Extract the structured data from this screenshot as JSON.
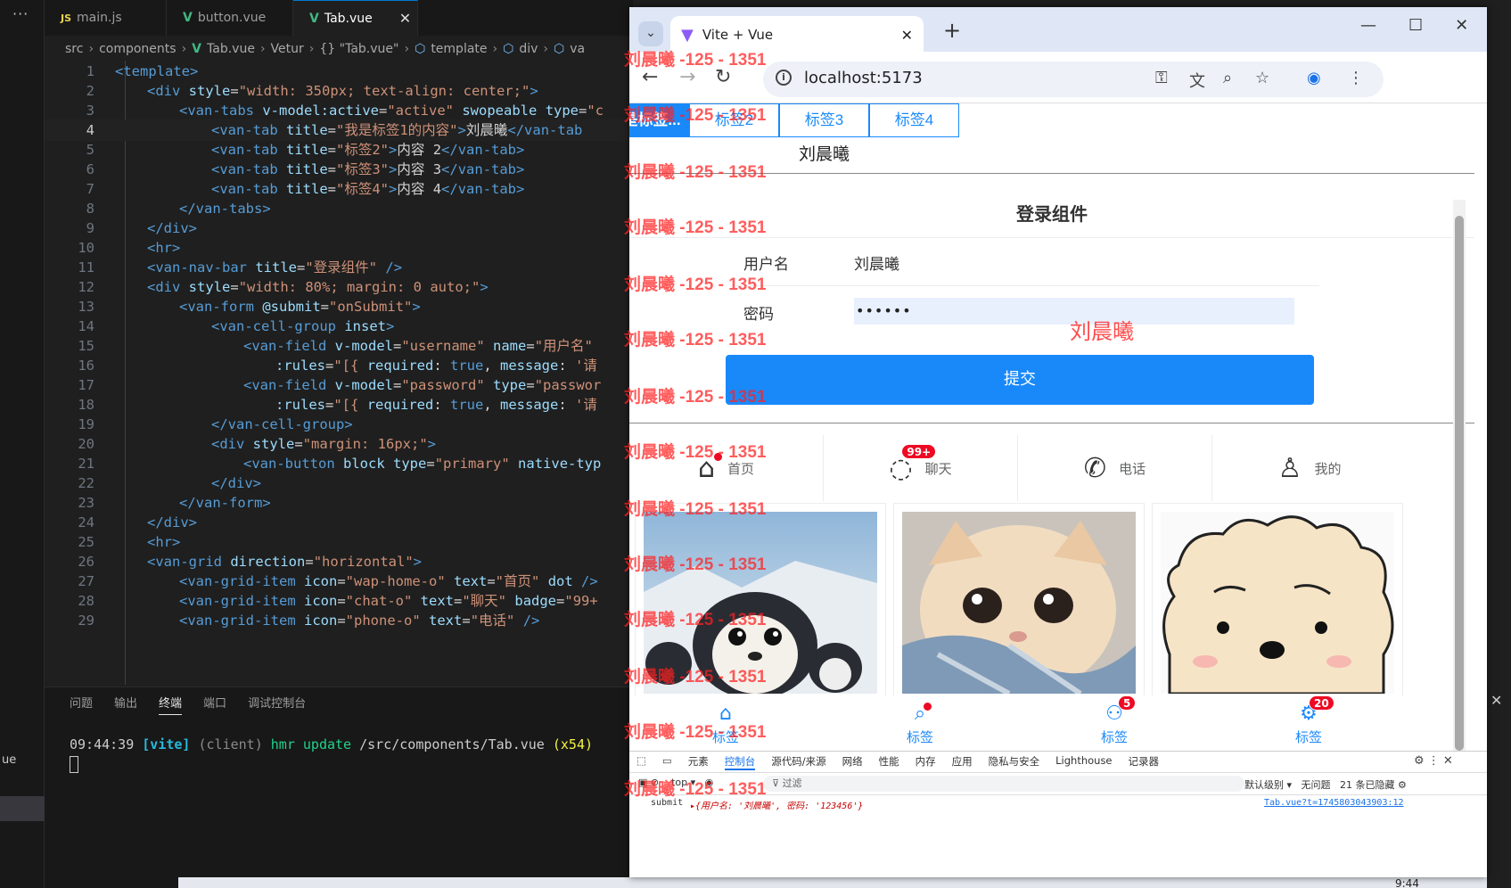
{
  "vscode": {
    "tabs": [
      {
        "icon": "JS",
        "name": "main.js"
      },
      {
        "icon": "V",
        "name": "button.vue"
      },
      {
        "icon": "V",
        "name": "Tab.vue"
      }
    ],
    "breadcrumbs": [
      "src",
      "components",
      "Tab.vue",
      "Vetur",
      "{} \"Tab.vue\"",
      "template",
      "div",
      "va"
    ],
    "code_lines": [
      {
        "n": "1",
        "html": "<span class='tg'>&lt;template&gt;</span>",
        "indent": 0
      },
      {
        "n": "2",
        "html": "<span class='tg'>&lt;div</span> <span class='at'>style</span>=<span class='sv'>\"width: 350px; text-align: center;\"</span><span class='tg'>&gt;</span>",
        "indent": 1
      },
      {
        "n": "3",
        "html": "<span class='tg'>&lt;van-tabs</span> <span class='at'>v-model:active</span>=<span class='sv'>\"active\"</span> <span class='at'>swopeable</span> <span class='at'>type</span>=<span class='sv'>\"c</span>",
        "indent": 2
      },
      {
        "n": "4",
        "html": "<span class='tg'>&lt;van-tab</span> <span class='at'>title</span>=<span class='sv'>\"我是标签1的内容\"</span><span class='tg'>&gt;</span>刘晨曦<span class='tg'>&lt;/van-tab</span>",
        "indent": 3
      },
      {
        "n": "5",
        "html": "<span class='tg'>&lt;van-tab</span> <span class='at'>title</span>=<span class='sv'>\"标签2\"</span><span class='tg'>&gt;</span>内容 2<span class='tg'>&lt;/van-tab&gt;</span>",
        "indent": 3
      },
      {
        "n": "6",
        "html": "<span class='tg'>&lt;van-tab</span> <span class='at'>title</span>=<span class='sv'>\"标签3\"</span><span class='tg'>&gt;</span>内容 3<span class='tg'>&lt;/van-tab&gt;</span>",
        "indent": 3
      },
      {
        "n": "7",
        "html": "<span class='tg'>&lt;van-tab</span> <span class='at'>title</span>=<span class='sv'>\"标签4\"</span><span class='tg'>&gt;</span>内容 4<span class='tg'>&lt;/van-tab&gt;</span>",
        "indent": 3
      },
      {
        "n": "8",
        "html": "<span class='tg'>&lt;/van-tabs&gt;</span>",
        "indent": 2
      },
      {
        "n": "9",
        "html": "<span class='tg'>&lt;/div&gt;</span>",
        "indent": 1
      },
      {
        "n": "10",
        "html": "<span class='tg'>&lt;hr&gt;</span>",
        "indent": 1
      },
      {
        "n": "11",
        "html": "<span class='tg'>&lt;van-nav-bar</span> <span class='at'>title</span>=<span class='sv'>\"登录组件\"</span> <span class='tg'>/&gt;</span>",
        "indent": 1
      },
      {
        "n": "12",
        "html": "<span class='tg'>&lt;div</span> <span class='at'>style</span>=<span class='sv'>\"width: 80%; margin: 0 auto;\"</span><span class='tg'>&gt;</span>",
        "indent": 1
      },
      {
        "n": "13",
        "html": "<span class='tg'>&lt;van-form</span> <span class='at'>@submit</span>=<span class='sv'>\"onSubmit\"</span><span class='tg'>&gt;</span>",
        "indent": 2
      },
      {
        "n": "14",
        "html": "<span class='tg'>&lt;van-cell-group</span> <span class='at'>inset</span><span class='tg'>&gt;</span>",
        "indent": 3
      },
      {
        "n": "15",
        "html": "<span class='tg'>&lt;van-field</span> <span class='at'>v-model</span>=<span class='sv'>\"username\"</span> <span class='at'>name</span>=<span class='sv'>\"用户名\"</span>",
        "indent": 4
      },
      {
        "n": "16",
        "html": "<span class='at'>:rules</span>=<span class='sv'>\"[{</span> <span class='at'>required</span>: <span class='tg'>true</span>, <span class='at'>message</span>: <span class='sv'>'请</span>",
        "indent": 5
      },
      {
        "n": "17",
        "html": "<span class='tg'>&lt;van-field</span> <span class='at'>v-model</span>=<span class='sv'>\"password\"</span> <span class='at'>type</span>=<span class='sv'>\"passwor</span>",
        "indent": 4
      },
      {
        "n": "18",
        "html": "<span class='at'>:rules</span>=<span class='sv'>\"[{</span> <span class='at'>required</span>: <span class='tg'>true</span>, <span class='at'>message</span>: <span class='sv'>'请</span>",
        "indent": 5
      },
      {
        "n": "19",
        "html": "<span class='tg'>&lt;/van-cell-group&gt;</span>",
        "indent": 3
      },
      {
        "n": "20",
        "html": "<span class='tg'>&lt;div</span> <span class='at'>style</span>=<span class='sv'>\"margin: 16px;\"</span><span class='tg'>&gt;</span>",
        "indent": 3
      },
      {
        "n": "21",
        "html": "<span class='tg'>&lt;van-button</span> <span class='at'>block</span> <span class='at'>type</span>=<span class='sv'>\"primary\"</span> <span class='at'>native-typ</span>",
        "indent": 4
      },
      {
        "n": "22",
        "html": "<span class='tg'>&lt;/div&gt;</span>",
        "indent": 3
      },
      {
        "n": "23",
        "html": "<span class='tg'>&lt;/van-form&gt;</span>",
        "indent": 2
      },
      {
        "n": "24",
        "html": "<span class='tg'>&lt;/div&gt;</span>",
        "indent": 1
      },
      {
        "n": "25",
        "html": "<span class='tg'>&lt;hr&gt;</span>",
        "indent": 1
      },
      {
        "n": "26",
        "html": "<span class='tg'>&lt;van-grid</span> <span class='at'>direction</span>=<span class='sv'>\"horizontal\"</span><span class='tg'>&gt;</span>",
        "indent": 1
      },
      {
        "n": "27",
        "html": "<span class='tg'>&lt;van-grid-item</span> <span class='at'>icon</span>=<span class='sv'>\"wap-home-o\"</span> <span class='at'>text</span>=<span class='sv'>\"首页\"</span> <span class='at'>dot</span> <span class='tg'>/&gt;</span>",
        "indent": 2
      },
      {
        "n": "28",
        "html": "<span class='tg'>&lt;van-grid-item</span> <span class='at'>icon</span>=<span class='sv'>\"chat-o\"</span> <span class='at'>text</span>=<span class='sv'>\"聊天\"</span> <span class='at'>badge</span>=<span class='sv'>\"99+</span>",
        "indent": 2
      },
      {
        "n": "29",
        "html": "<span class='tg'>&lt;van-grid-item</span> <span class='at'>icon</span>=<span class='sv'>\"phone-o\"</span> <span class='at'>text</span>=<span class='sv'>\"电话\"</span> <span class='tg'>/&gt;</span>",
        "indent": 2
      }
    ],
    "panel_tabs": [
      "问题",
      "输出",
      "终端",
      "端口",
      "调试控制台"
    ],
    "active_panel_tab": "终端",
    "terminal": {
      "time": "09:44:39",
      "tag": "[vite]",
      "client": "(client)",
      "action": "hmr update",
      "path": "/src/components/Tab.vue",
      "count": "(x54)"
    },
    "sidebar_fragment": "ue"
  },
  "browser": {
    "tab_title": "Vite + Vue",
    "url": "localhost:5173",
    "page": {
      "tabs": [
        "我是标签...",
        "标签2",
        "标签3",
        "标签4"
      ],
      "tab_content": "刘晨曦",
      "nav_title": "登录组件",
      "form": {
        "username_label": "用户名",
        "username_value": "刘晨曦",
        "password_label": "密码",
        "password_value": "••••••",
        "submit_label": "提交"
      },
      "grid": [
        {
          "icon": "home-icon",
          "glyph": "⌂",
          "text": "首页"
        },
        {
          "icon": "chat-icon",
          "glyph": "💬",
          "text": "聊天",
          "badge": "99+"
        },
        {
          "icon": "phone-icon",
          "glyph": "✆",
          "text": "电话"
        },
        {
          "icon": "user-icon",
          "glyph": "👤",
          "text": "我的"
        }
      ],
      "tabbar": [
        {
          "icon": "home-icon",
          "text": "标签"
        },
        {
          "icon": "search-icon",
          "text": "标签"
        },
        {
          "icon": "friends-icon",
          "text": "标签",
          "badge": "5"
        },
        {
          "icon": "settings-icon",
          "text": "标签",
          "badge": "20"
        }
      ]
    },
    "devtools": {
      "tabs": [
        "元素",
        "控制台",
        "源代码/来源",
        "网络",
        "性能",
        "内存",
        "应用",
        "隐私与安全",
        "Lighthouse",
        "记录器"
      ],
      "active_tab": "控制台",
      "context": "top",
      "filter_placeholder": "过滤",
      "level": "默认级别",
      "issues": "无问题",
      "hidden": "21 条已隐藏",
      "log_label": "submit",
      "log_message": "▸{用户名: '刘晨曦', 密码: '123456'}",
      "log_source": "Tab.vue?t=1745803043903:12"
    }
  },
  "watermark": {
    "text": "刘晨曦 -125 - 1351",
    "name": "刘晨曦"
  },
  "clock": "9:44"
}
